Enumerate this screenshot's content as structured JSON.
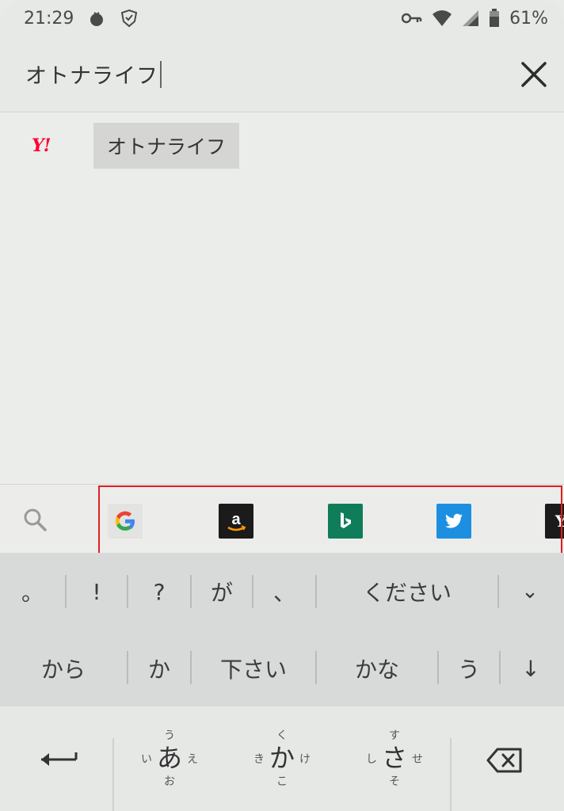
{
  "status_bar": {
    "time": "21:29",
    "battery": "61%",
    "icons": [
      "tomato-icon",
      "shield-check-icon",
      "key-icon",
      "wifi-icon",
      "signal-icon",
      "battery-icon"
    ]
  },
  "search": {
    "query": "オトナライフ",
    "close_icon": "close-icon"
  },
  "suggestions": [
    {
      "provider": "Y!",
      "text": "オトナライフ"
    }
  ],
  "engines": [
    {
      "name": "Google",
      "icon": "google-icon",
      "letter": "G"
    },
    {
      "name": "Amazon",
      "icon": "amazon-icon",
      "letter": "a"
    },
    {
      "name": "Bing",
      "icon": "bing-icon",
      "letter": "b"
    },
    {
      "name": "Twitter",
      "icon": "twitter-icon"
    },
    {
      "name": "Yahoo",
      "icon": "yahoo-icon",
      "letter": "Y"
    }
  ],
  "candidates_row1": [
    "。",
    "!",
    "?",
    "が",
    "、",
    "ください"
  ],
  "candidates_row2": [
    "から",
    "か",
    "下さい",
    "かな",
    "う"
  ],
  "expand_glyph": "⌄",
  "down_arrow_glyph": "↓",
  "keyboard": {
    "keys": [
      {
        "main": "あ",
        "up": "う",
        "left": "い",
        "right": "え",
        "down": "お"
      },
      {
        "main": "か",
        "up": "く",
        "left": "き",
        "right": "け",
        "down": "こ"
      },
      {
        "main": "さ",
        "up": "す",
        "left": "し",
        "right": "せ",
        "down": "そ"
      }
    ]
  },
  "colors": {
    "highlight_border": "#e02020",
    "yahoo_red": "#ff0033",
    "bing_green": "#0f7d59",
    "twitter_blue": "#1d8fe1",
    "amazon_black": "#1b1b1b"
  }
}
